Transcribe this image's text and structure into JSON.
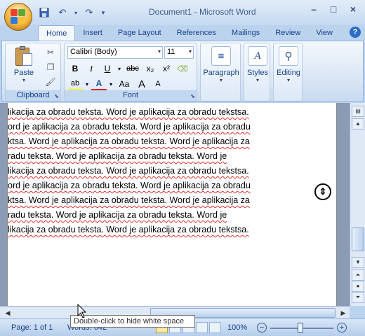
{
  "window": {
    "title": "Document1 - Microsoft Word",
    "controls": [
      "–",
      "□",
      "×"
    ]
  },
  "qat": {
    "save_icon": "save-icon",
    "undo_icon": "undo-icon",
    "redo_icon": "redo-icon"
  },
  "tabs": [
    {
      "label": "Home"
    },
    {
      "label": "Insert"
    },
    {
      "label": "Page Layout"
    },
    {
      "label": "References"
    },
    {
      "label": "Mailings"
    },
    {
      "label": "Review"
    },
    {
      "label": "View"
    }
  ],
  "ribbon": {
    "clipboard": {
      "paste_label": "Paste",
      "group_label": "Clipboard"
    },
    "font": {
      "font_name": "Calibri (Body)",
      "font_size": "11",
      "group_label": "Font",
      "bold": "B",
      "italic": "I",
      "underline": "U",
      "strikethrough": "abc",
      "subscript": "x₂",
      "superscript": "x²",
      "grow": "A",
      "shrink": "A",
      "change_case": "Aa"
    },
    "paragraph": {
      "label": "Paragraph"
    },
    "styles": {
      "label": "Styles"
    },
    "editing": {
      "label": "Editing"
    }
  },
  "document": {
    "lines": [
      "likacija za obradu teksta. Word je aplikacija za obradu tekstsa.",
      "ord je aplikacija za obradu teksta. Word je aplikacija za obradu",
      "ktsa. Word je aplikacija za obradu teksta. Word je aplikacija za",
      "radu teksta. Word je aplikacija za obradu teksta. Word je",
      "likacija za obradu teksta. Word je aplikacija za obradu tekstsa.",
      "ord je aplikacija za obradu teksta. Word je aplikacija za obradu",
      "ktsa. Word je aplikacija za obradu teksta. Word je aplikacija za",
      "radu teksta. Word je aplikacija za obradu teksta. Word je",
      "likacija za obradu teksta. Word je aplikacija za obradu tekstsa."
    ]
  },
  "statusbar": {
    "page": "Page: 1 of 1",
    "words": "Words: 642",
    "zoom": "100%",
    "zoom_minus": "−",
    "zoom_plus": "+"
  },
  "tooltip": {
    "text": "Double-click to hide white space"
  }
}
